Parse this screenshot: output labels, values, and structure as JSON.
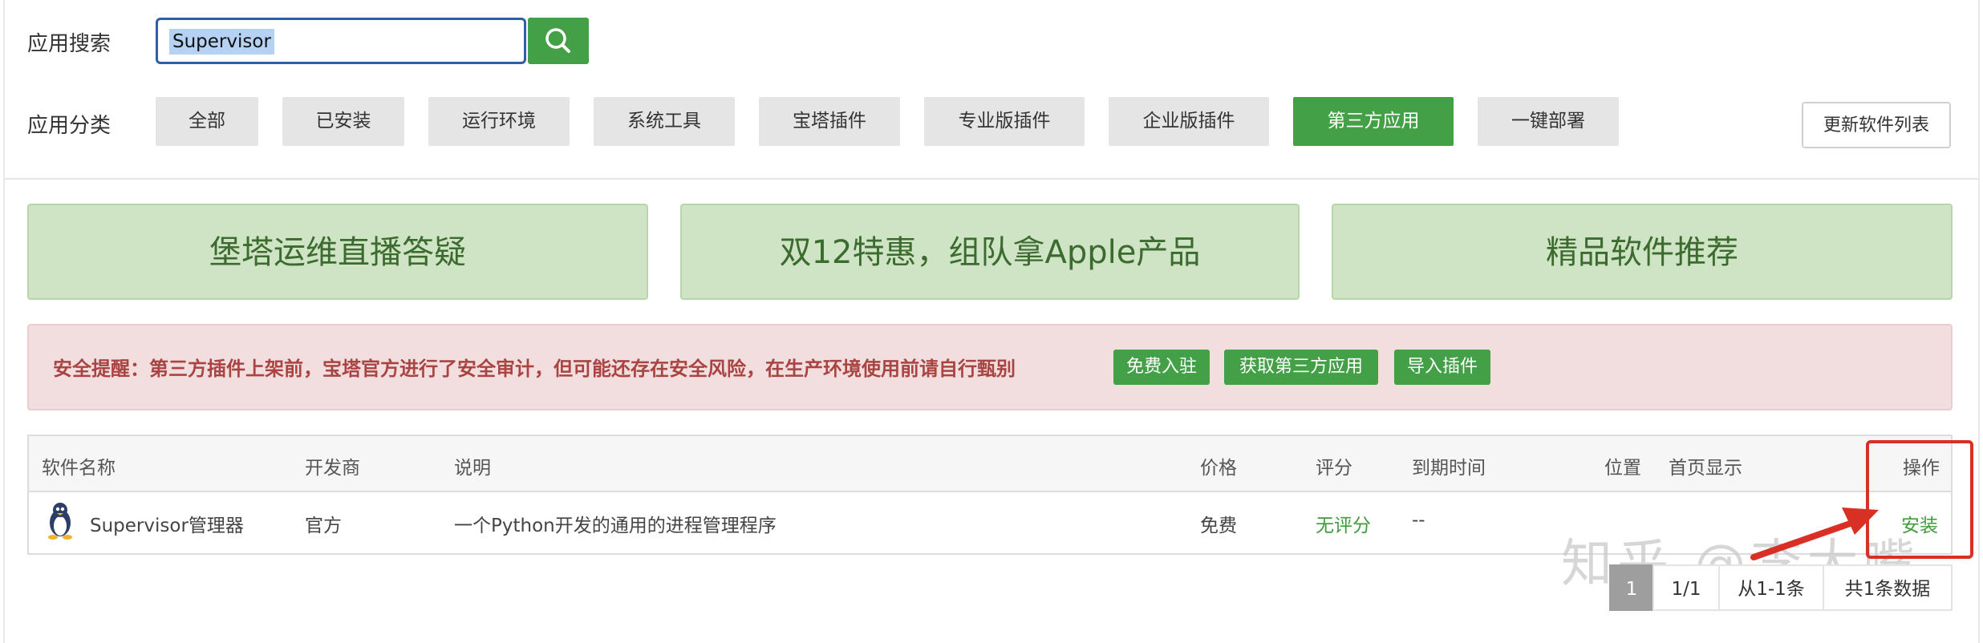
{
  "search": {
    "label": "应用搜索",
    "value": "Supervisor",
    "button_icon": "search-icon"
  },
  "category": {
    "label": "应用分类",
    "tabs": [
      {
        "label": "全部",
        "active": false
      },
      {
        "label": "已安装",
        "active": false
      },
      {
        "label": "运行环境",
        "active": false
      },
      {
        "label": "系统工具",
        "active": false
      },
      {
        "label": "宝塔插件",
        "active": false
      },
      {
        "label": "专业版插件",
        "active": false
      },
      {
        "label": "企业版插件",
        "active": false
      },
      {
        "label": "第三方应用",
        "active": true
      },
      {
        "label": "一键部署",
        "active": false
      }
    ],
    "refresh_label": "更新软件列表"
  },
  "banners": [
    "堡塔运维直播答疑",
    "双12特惠，组队拿Apple产品",
    "精品软件推荐"
  ],
  "alert": {
    "text": "安全提醒：第三方插件上架前，宝塔官方进行了安全审计，但可能还存在安全风险，在生产环境使用前请自行甄别",
    "buttons": [
      "免费入驻",
      "获取第三方应用",
      "导入插件"
    ]
  },
  "table": {
    "headers": [
      "软件名称",
      "开发商",
      "说明",
      "价格",
      "评分",
      "到期时间",
      "位置",
      "首页显示",
      "操作"
    ],
    "rows": [
      {
        "icon": "linux-penguin-icon",
        "name": "Supervisor管理器",
        "developer": "官方",
        "description": "一个Python开发的通用的进程管理程序",
        "price": "免费",
        "rating": "无评分",
        "expiry": "--",
        "action": "安装"
      }
    ]
  },
  "pagination": {
    "current": "1",
    "pages": "1/1",
    "range": "从1-1条",
    "total": "共1条数据"
  },
  "watermark": "知乎 @李大嘴",
  "colors": {
    "accent_green": "#43a047",
    "alert_text": "#a94442",
    "annotation_red": "#d93025"
  }
}
